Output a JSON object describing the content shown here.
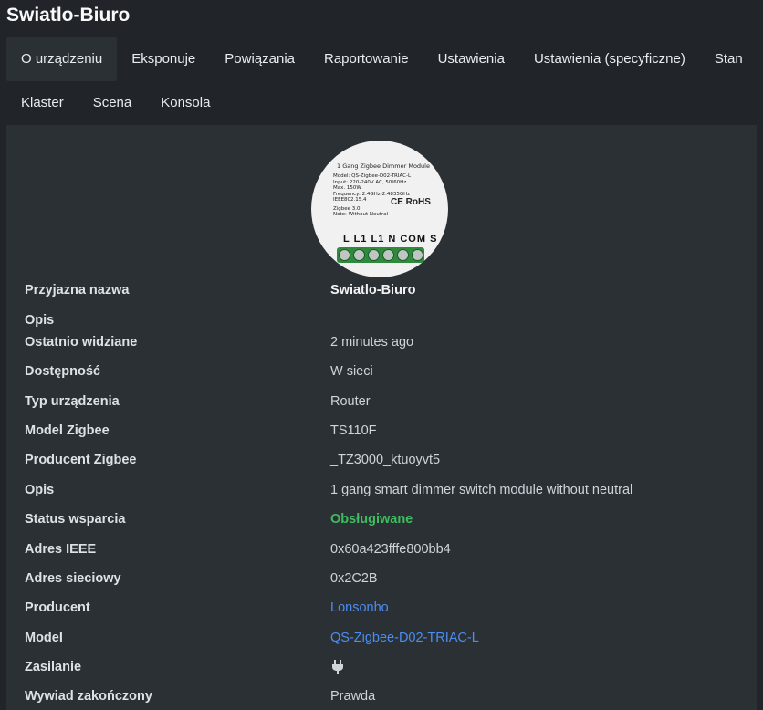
{
  "page": {
    "title": "Swiatlo-Biuro"
  },
  "tabs": [
    {
      "label": "O urządzeniu",
      "active": true
    },
    {
      "label": "Eksponuje",
      "active": false
    },
    {
      "label": "Powiązania",
      "active": false
    },
    {
      "label": "Raportowanie",
      "active": false
    },
    {
      "label": "Ustawienia",
      "active": false
    },
    {
      "label": "Ustawienia (specyficzne)",
      "active": false
    },
    {
      "label": "Stan",
      "active": false
    },
    {
      "label": "Klaster",
      "active": false
    },
    {
      "label": "Scena",
      "active": false
    },
    {
      "label": "Konsola",
      "active": false
    }
  ],
  "device_image": {
    "title": "1 Gang Zigbee Dimmer Module",
    "specs": [
      "Model: QS-Zigbee-D02-TRIAC-L",
      "Input: 220-240V AC, 50/60Hz",
      "Max. 150W",
      "Frequency: 2.4GHz-2.4835GHz",
      "IEEE802.15.4",
      "Zigbee 3.0",
      "Note: Without Neutral"
    ],
    "marks": "CE RoHS",
    "terminals": "L L1 L1 N COM S"
  },
  "properties": [
    {
      "label": "Przyjazna nazwa",
      "value": "Swiatlo-Biuro"
    },
    {
      "label": "Opis",
      "value": ""
    },
    {
      "label": "Ostatnio widziane",
      "value": "2 minutes ago"
    },
    {
      "label": "Dostępność",
      "value": "W sieci"
    },
    {
      "label": "Typ urządzenia",
      "value": "Router"
    },
    {
      "label": "Model Zigbee",
      "value": "TS110F"
    },
    {
      "label": "Producent Zigbee",
      "value": "_TZ3000_ktuoyvt5"
    },
    {
      "label": "Opis",
      "value": "1 gang smart dimmer switch module without neutral"
    },
    {
      "label": "Status wsparcia",
      "value": "Obsługiwane"
    },
    {
      "label": "Adres IEEE",
      "value": "0x60a423fffe800bb4"
    },
    {
      "label": "Adres sieciowy",
      "value": "0x2C2B"
    },
    {
      "label": "Producent",
      "value": "Lonsonho"
    },
    {
      "label": "Model",
      "value": "QS-Zigbee-D02-TRIAC-L"
    },
    {
      "label": "Zasilanie",
      "value": "",
      "icon": "plug-icon"
    },
    {
      "label": "Wywiad zakończony",
      "value": "Prawda"
    }
  ],
  "colors": {
    "background": "#212529",
    "panel": "#2b3035",
    "supported": "#3dbd5d",
    "link": "#4c8df0"
  }
}
